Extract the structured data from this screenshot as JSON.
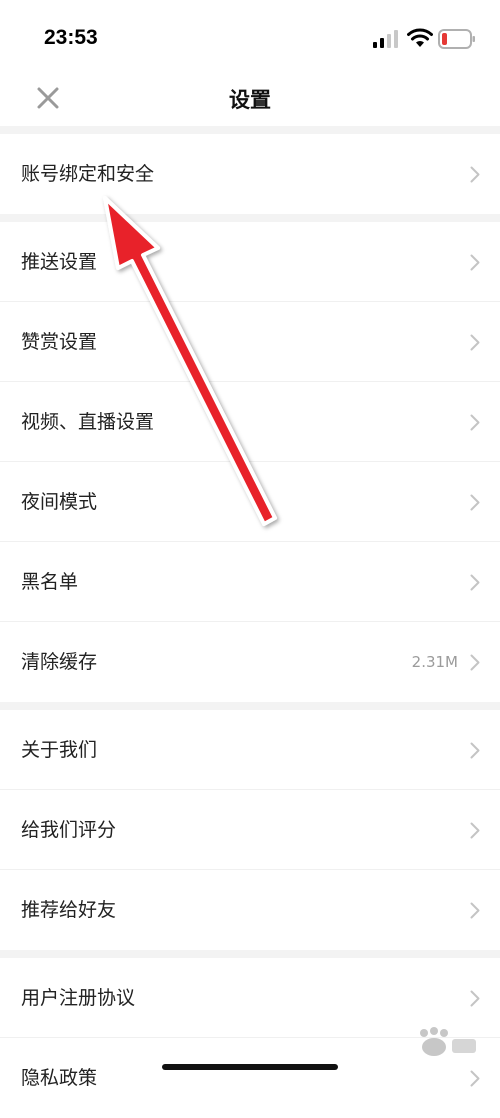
{
  "status_bar": {
    "time": "23:53",
    "signal_icon": "signal-icon",
    "wifi_icon": "wifi-icon",
    "battery_icon": "battery-icon",
    "battery_low_color": "#e53935"
  },
  "header": {
    "title": "设置",
    "close_icon": "close-icon"
  },
  "groups": [
    {
      "items": [
        {
          "label": "账号绑定和安全"
        }
      ]
    },
    {
      "items": [
        {
          "label": "推送设置"
        },
        {
          "label": "赞赏设置"
        },
        {
          "label": "视频、直播设置"
        },
        {
          "label": "夜间模式"
        },
        {
          "label": "黑名单"
        },
        {
          "label": "清除缓存",
          "value": "2.31M"
        }
      ]
    },
    {
      "items": [
        {
          "label": "关于我们"
        },
        {
          "label": "给我们评分"
        },
        {
          "label": "推荐给好友"
        }
      ]
    },
    {
      "items": [
        {
          "label": "用户注册协议"
        },
        {
          "label": "隐私政策"
        }
      ]
    }
  ],
  "annotation": {
    "arrow_color": "#e8222a",
    "arrow_icon": "red-arrow-annotation"
  },
  "watermark": {
    "icon": "baidu-jingyan-watermark"
  }
}
